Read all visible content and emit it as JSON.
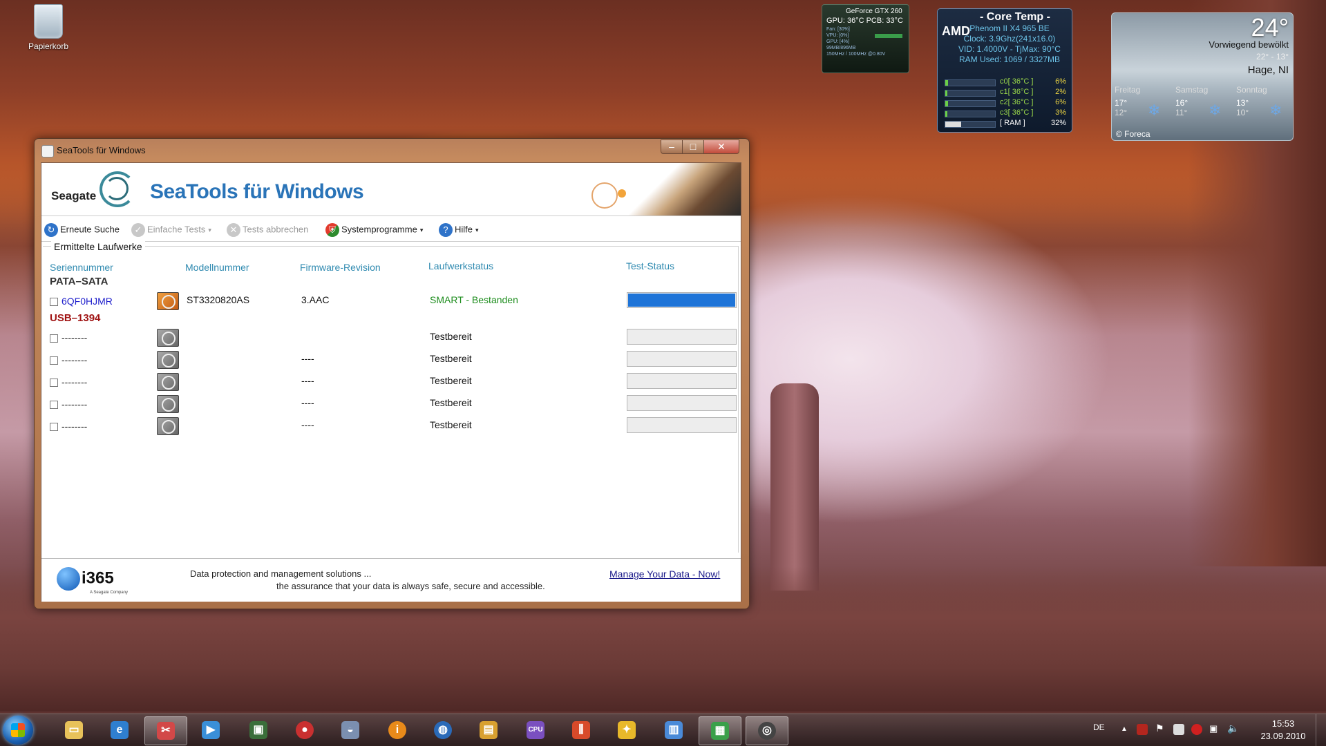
{
  "desktop": {
    "recycle_bin_label": "Papierkorb"
  },
  "gpu_gadget": {
    "title": "GeForce GTX 260",
    "gpu_temp": "GPU: 36°C PCB: 33°C",
    "fan": "Fan: [30%]",
    "vpu": "VPU: [0%]",
    "gpu_load": "GPU: [4%]",
    "memory": "99MB/896MB",
    "clocks": "150MHz / 100MHz @0.80V"
  },
  "core_temp": {
    "title": "- Core Temp -",
    "vendor": "AMD",
    "cpu": "Phenom II X4 965 BE",
    "clock": "Clock: 3.9Ghz(241x16.0)",
    "vid": "VID: 1.4000V - TjMax: 90°C",
    "ram": "RAM Used: 1069 / 3327MB",
    "cores": [
      {
        "label": "c0[ 36°C ]",
        "load": "6%",
        "fill": 0.06
      },
      {
        "label": "c1[ 36°C ]",
        "load": "2%",
        "fill": 0.02
      },
      {
        "label": "c2[ 36°C ]",
        "load": "6%",
        "fill": 0.06
      },
      {
        "label": "c3[ 36°C ]",
        "load": "3%",
        "fill": 0.03
      },
      {
        "label": "[ RAM ]",
        "load": "32%",
        "fill": 0.32
      }
    ]
  },
  "weather": {
    "temp": "24°",
    "condition": "Vorwiegend bewölkt",
    "range": "22° - 13°",
    "location": "Hage, NI",
    "forecast": [
      {
        "day": "Freitag",
        "hi": "17°",
        "lo": "12°"
      },
      {
        "day": "Samstag",
        "hi": "16°",
        "lo": "11°"
      },
      {
        "day": "Sonntag",
        "hi": "13°",
        "lo": "10°"
      }
    ],
    "credit": "© Foreca"
  },
  "window": {
    "title": "SeaTools für Windows",
    "brand_left": "Seagate",
    "brand_title": "SeaTools für Windows",
    "toolbar": {
      "rescan": "Erneute Suche",
      "basic_tests": "Einfache Tests",
      "abort_tests": "Tests abbrechen",
      "system_programs": "Systemprogramme",
      "help": "Hilfe"
    },
    "group_title": "Ermittelte Laufwerke",
    "columns": {
      "serial": "Seriennummer",
      "model": "Modellnummer",
      "firmware": "Firmware-Revision",
      "drive_status": "Laufwerkstatus",
      "test_status": "Test-Status"
    },
    "section_pata": "PATA–SATA",
    "section_usb": "USB–1394",
    "pata_drive": {
      "serial": "6QF0HJMR",
      "model": "ST3320820AS",
      "firmware": "3.AAC",
      "status": "SMART - Bestanden",
      "progress": 1.0
    },
    "usb_drives": [
      {
        "serial": "--------",
        "firmware": "",
        "status": "Testbereit"
      },
      {
        "serial": "--------",
        "firmware": "----",
        "status": "Testbereit"
      },
      {
        "serial": "--------",
        "firmware": "----",
        "status": "Testbereit"
      },
      {
        "serial": "--------",
        "firmware": "----",
        "status": "Testbereit"
      },
      {
        "serial": "--------",
        "firmware": "----",
        "status": "Testbereit"
      }
    ],
    "footer": {
      "logo": "i365",
      "logo_sub": "A Seagate Company",
      "line1": "Data protection and management solutions ...",
      "line2": "the assurance that your data is always safe, secure and accessible.",
      "link": "Manage Your Data - Now!"
    }
  },
  "taskbar": {
    "language": "DE",
    "time": "15:53",
    "date": "23.09.2010"
  }
}
